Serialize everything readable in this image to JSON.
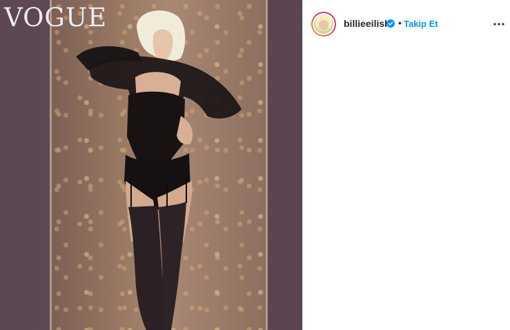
{
  "post": {
    "image_alt": "",
    "magazine_logo": "VOGUE"
  },
  "header": {
    "username": "billieeilish",
    "separator": "•",
    "follow_label": "Takip Et",
    "more_icon": "more-horizontal-icon",
    "verified_icon": "verified-badge-icon"
  },
  "colors": {
    "follow": "#0095f6",
    "verified": "#0095f6",
    "text": "#262626"
  }
}
